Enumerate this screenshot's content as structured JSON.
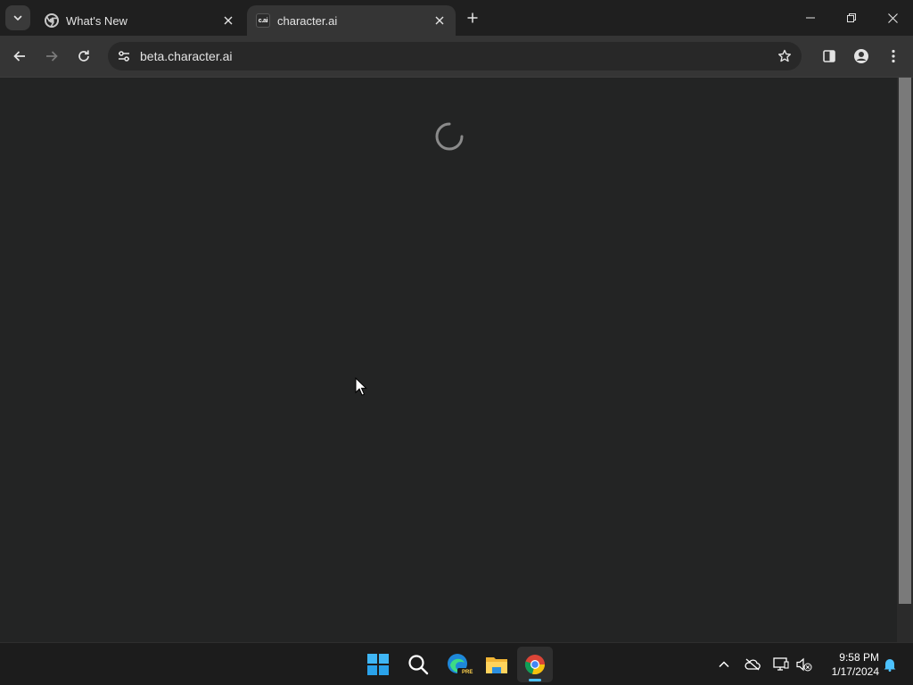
{
  "browser": {
    "tabs": [
      {
        "title": "What's New",
        "favicon": "chrome-icon",
        "active": false
      },
      {
        "title": "character.ai",
        "favicon": "c.ai",
        "active": true
      }
    ],
    "address_bar": {
      "url": "beta.character.ai"
    }
  },
  "page": {
    "state": "loading"
  },
  "taskbar": {
    "apps": [
      {
        "name": "Start",
        "icon": "windows-start-icon"
      },
      {
        "name": "Search",
        "icon": "search-icon"
      },
      {
        "name": "Microsoft Edge Beta",
        "icon": "edge-pre-icon",
        "badge": "PRE"
      },
      {
        "name": "File Explorer",
        "icon": "folder-icon"
      },
      {
        "name": "Google Chrome",
        "icon": "chrome-icon",
        "active": true
      }
    ],
    "clock": {
      "time": "9:58 PM",
      "date": "1/17/2024"
    }
  },
  "colors": {
    "page_bg": "#232424",
    "toolbar_bg": "#353535",
    "tabstrip_bg": "#1f1f1f",
    "taskbar_bg": "#1c1c1c",
    "accent": "#4cc2ff"
  }
}
